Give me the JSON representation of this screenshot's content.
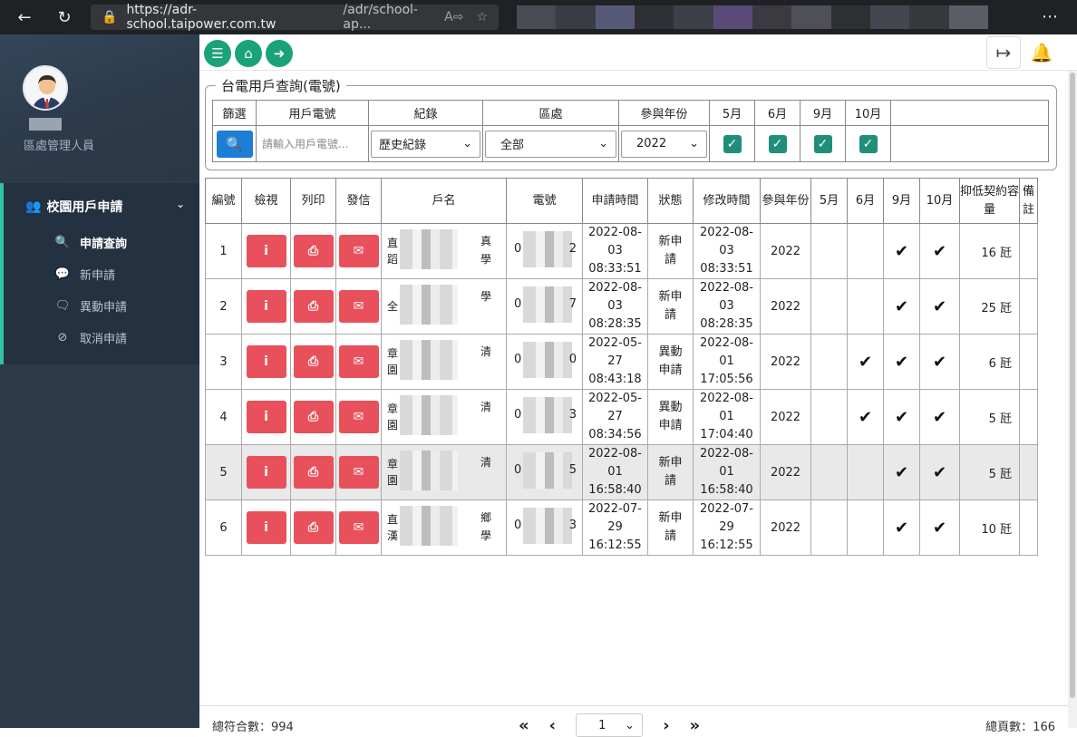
{
  "browser": {
    "url_host": "https://adr-school.taipower.com.tw",
    "url_path": "/adr/school-ap...",
    "back_icon": "back-arrow-icon",
    "refresh_icon": "refresh-icon"
  },
  "sidebar": {
    "role": "區處管理人員",
    "group_label": "校園用戶申請",
    "items": [
      {
        "label": "申請查詢",
        "icon": "search-icon",
        "active": true
      },
      {
        "label": "新申請",
        "icon": "comment-icon",
        "active": false
      },
      {
        "label": "異動申請",
        "icon": "comment-edit-icon",
        "active": false
      },
      {
        "label": "取消申請",
        "icon": "comment-slash-icon",
        "active": false
      }
    ]
  },
  "query": {
    "title": "台電用戶查詢(電號)",
    "headers": [
      "篩選",
      "用戶電號",
      "紀錄",
      "區處",
      "參與年份",
      "5月",
      "6月",
      "9月",
      "10月"
    ],
    "phone_placeholder": "請輸入用戶電號...",
    "record_value": "歷史紀錄",
    "region_value": "全部",
    "year_value": "2022",
    "check_mark": "✓"
  },
  "table": {
    "headers": [
      "編號",
      "檢視",
      "列印",
      "發信",
      "戶名",
      "電號",
      "申請時間",
      "狀態",
      "修改時間",
      "參與年份",
      "5月",
      "6月",
      "9月",
      "10月",
      "抑低契約容量",
      "備註"
    ],
    "rows": [
      {
        "no": "1",
        "name_l": "直",
        "name_l2": "蹈",
        "name_r": "真",
        "name_r2": "學",
        "phone_l": "0",
        "phone_r": "2",
        "apply_date": "2022-08-03",
        "apply_time": "08:33:51",
        "status1": "新申",
        "status2": "請",
        "mod_date": "2022-08-03",
        "mod_time": "08:33:51",
        "year": "2022",
        "m5": "",
        "m6": "",
        "m9": "✔",
        "m10": "✔",
        "capacity": "16 瓩"
      },
      {
        "no": "2",
        "name_l": "全",
        "name_l2": "",
        "name_r": "學",
        "name_r2": "",
        "phone_l": "0",
        "phone_r": "7",
        "apply_date": "2022-08-03",
        "apply_time": "08:28:35",
        "status1": "新申",
        "status2": "請",
        "mod_date": "2022-08-03",
        "mod_time": "08:28:35",
        "year": "2022",
        "m5": "",
        "m6": "",
        "m9": "✔",
        "m10": "✔",
        "capacity": "25 瓩"
      },
      {
        "no": "3",
        "name_l": "章",
        "name_l2": "園",
        "name_r": "清",
        "name_r2": "",
        "phone_l": "0",
        "phone_r": "0",
        "apply_date": "2022-05-27",
        "apply_time": "08:43:18",
        "status1": "異動",
        "status2": "申請",
        "mod_date": "2022-08-01",
        "mod_time": "17:05:56",
        "year": "2022",
        "m5": "",
        "m6": "✔",
        "m9": "✔",
        "m10": "✔",
        "capacity": "6 瓩"
      },
      {
        "no": "4",
        "name_l": "章",
        "name_l2": "園",
        "name_r": "清",
        "name_r2": "",
        "phone_l": "0",
        "phone_r": "3",
        "apply_date": "2022-05-27",
        "apply_time": "08:34:56",
        "status1": "異動",
        "status2": "申請",
        "mod_date": "2022-08-01",
        "mod_time": "17:04:40",
        "year": "2022",
        "m5": "",
        "m6": "✔",
        "m9": "✔",
        "m10": "✔",
        "capacity": "5 瓩"
      },
      {
        "no": "5",
        "name_l": "章",
        "name_l2": "園",
        "name_r": "清",
        "name_r2": "",
        "phone_l": "0",
        "phone_r": "5",
        "apply_date": "2022-08-01",
        "apply_time": "16:58:40",
        "status1": "新申",
        "status2": "請",
        "mod_date": "2022-08-01",
        "mod_time": "16:58:40",
        "year": "2022",
        "m5": "",
        "m6": "",
        "m9": "✔",
        "m10": "✔",
        "capacity": "5 瓩"
      },
      {
        "no": "6",
        "name_l": "直",
        "name_l2": "漢",
        "name_r": "鄉",
        "name_r2": "學",
        "phone_l": "0",
        "phone_r": "3",
        "apply_date": "2022-07-29",
        "apply_time": "16:12:55",
        "status1": "新申",
        "status2": "請",
        "mod_date": "2022-07-29",
        "mod_time": "16:12:55",
        "year": "2022",
        "m5": "",
        "m6": "",
        "m9": "✔",
        "m10": "✔",
        "capacity": "10 瓩"
      }
    ]
  },
  "footer": {
    "total_records": "總符合數：994",
    "total_pages": "總頁數：166",
    "page_value": "1",
    "first": "«",
    "prev": "‹",
    "next": "›",
    "last": "»"
  }
}
